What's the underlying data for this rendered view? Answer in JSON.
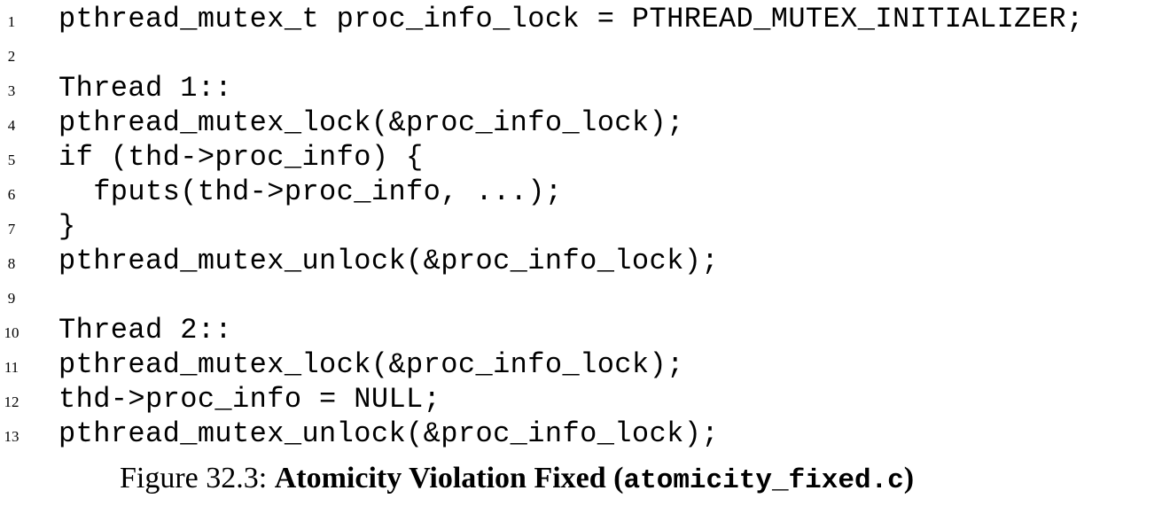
{
  "code": {
    "lines": [
      {
        "number": "1",
        "text": "pthread_mutex_t proc_info_lock = PTHREAD_MUTEX_INITIALIZER;"
      },
      {
        "number": "2",
        "text": ""
      },
      {
        "number": "3",
        "text": "Thread 1::"
      },
      {
        "number": "4",
        "text": "pthread_mutex_lock(&proc_info_lock);"
      },
      {
        "number": "5",
        "text": "if (thd->proc_info) {"
      },
      {
        "number": "6",
        "text": "  fputs(thd->proc_info, ...);"
      },
      {
        "number": "7",
        "text": "}"
      },
      {
        "number": "8",
        "text": "pthread_mutex_unlock(&proc_info_lock);"
      },
      {
        "number": "9",
        "text": ""
      },
      {
        "number": "10",
        "text": "Thread 2::"
      },
      {
        "number": "11",
        "text": "pthread_mutex_lock(&proc_info_lock);"
      },
      {
        "number": "12",
        "text": "thd->proc_info = NULL;"
      },
      {
        "number": "13",
        "text": "pthread_mutex_unlock(&proc_info_lock);"
      }
    ]
  },
  "caption": {
    "label": "Figure 32.3:",
    "title": "Atomicity Violation Fixed (",
    "filename": "atomicity_fixed.c",
    "close": ")"
  }
}
